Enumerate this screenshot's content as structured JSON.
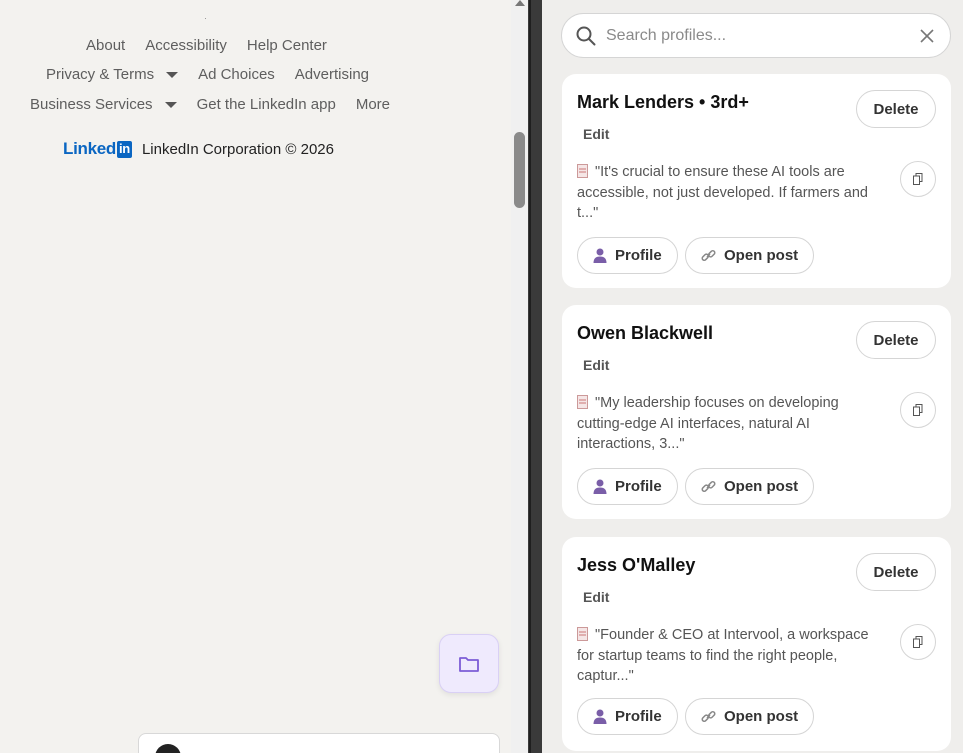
{
  "footer": {
    "row1": [
      "About",
      "Accessibility",
      "Help Center"
    ],
    "row2": [
      "Privacy & Terms",
      "Ad Choices",
      "Advertising"
    ],
    "row3": [
      "Business Services",
      "Get the LinkedIn app",
      "More"
    ],
    "logo_text": "Linked",
    "logo_in": "in",
    "copyright": "LinkedIn Corporation © 2026"
  },
  "search": {
    "placeholder": "Search profiles..."
  },
  "cards": [
    {
      "name": "Mark Lenders • 3rd+",
      "edit": "Edit",
      "delete": "Delete",
      "quote": "\"It's crucial to ensure these AI tools are accessible, not just developed. If farmers and t...\"",
      "profile": "Profile",
      "open_post": "Open post"
    },
    {
      "name": "Owen Blackwell",
      "edit": "Edit",
      "delete": "Delete",
      "quote": "\"My leadership focuses on developing cutting-edge AI interfaces, natural AI interactions, 3...\"",
      "profile": "Profile",
      "open_post": "Open post"
    },
    {
      "name": "Jess O'Malley",
      "edit": "Edit",
      "delete": "Delete",
      "quote": "\"Founder & CEO at Intervool, a workspace for startup teams to find the right people, captur...\"",
      "profile": "Profile",
      "open_post": "Open post"
    }
  ],
  "colors": {
    "linkedin_blue": "#0a66c2",
    "profile_icon": "#7a5ea8",
    "folder_icon": "#7c5cd6"
  }
}
